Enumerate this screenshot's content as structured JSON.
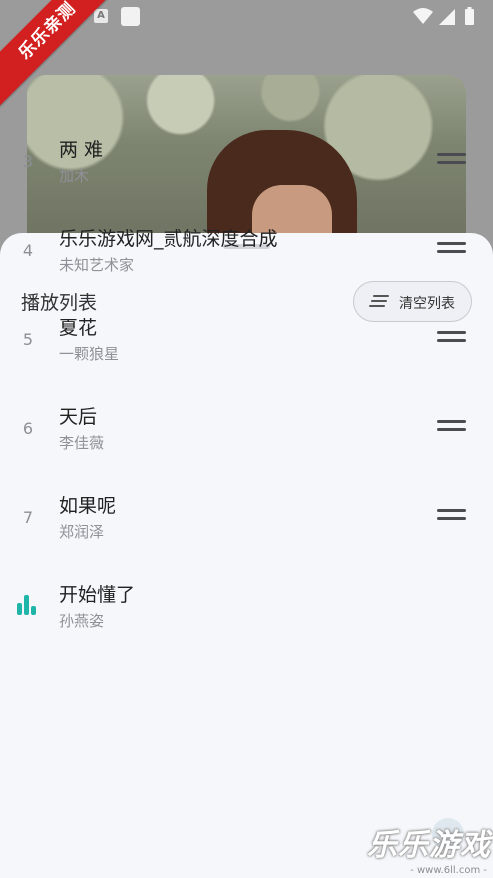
{
  "status_bar": {
    "ime_indicator": "A"
  },
  "corner_banner": "乐乐亲测",
  "playlist": {
    "title": "播放列表",
    "clear_button": "清空列表",
    "items": [
      {
        "index": "3",
        "title": "两 难",
        "artist": "加木",
        "playing": false
      },
      {
        "index": "4",
        "title": "乐乐游戏网_贰航深度合成",
        "artist": "未知艺术家",
        "playing": false
      },
      {
        "index": "5",
        "title": "夏花",
        "artist": "一颗狼星",
        "playing": false
      },
      {
        "index": "6",
        "title": "天后",
        "artist": "李佳薇",
        "playing": false
      },
      {
        "index": "7",
        "title": "如果呢",
        "artist": "郑润泽",
        "playing": false
      },
      {
        "index": "",
        "title": "开始懂了",
        "artist": "孙燕姿",
        "playing": true
      }
    ]
  },
  "icons": {
    "clear": "list-clear-icon",
    "drag": "drag-handle-icon",
    "now_playing": "equalizer-icon"
  },
  "colors": {
    "accent": "#1fb5a8",
    "sheet_bg": "#f6f7fb",
    "banner": "#d21f1f"
  },
  "watermark": {
    "text": "乐乐游戏",
    "url": "- www.6ll.com -"
  }
}
